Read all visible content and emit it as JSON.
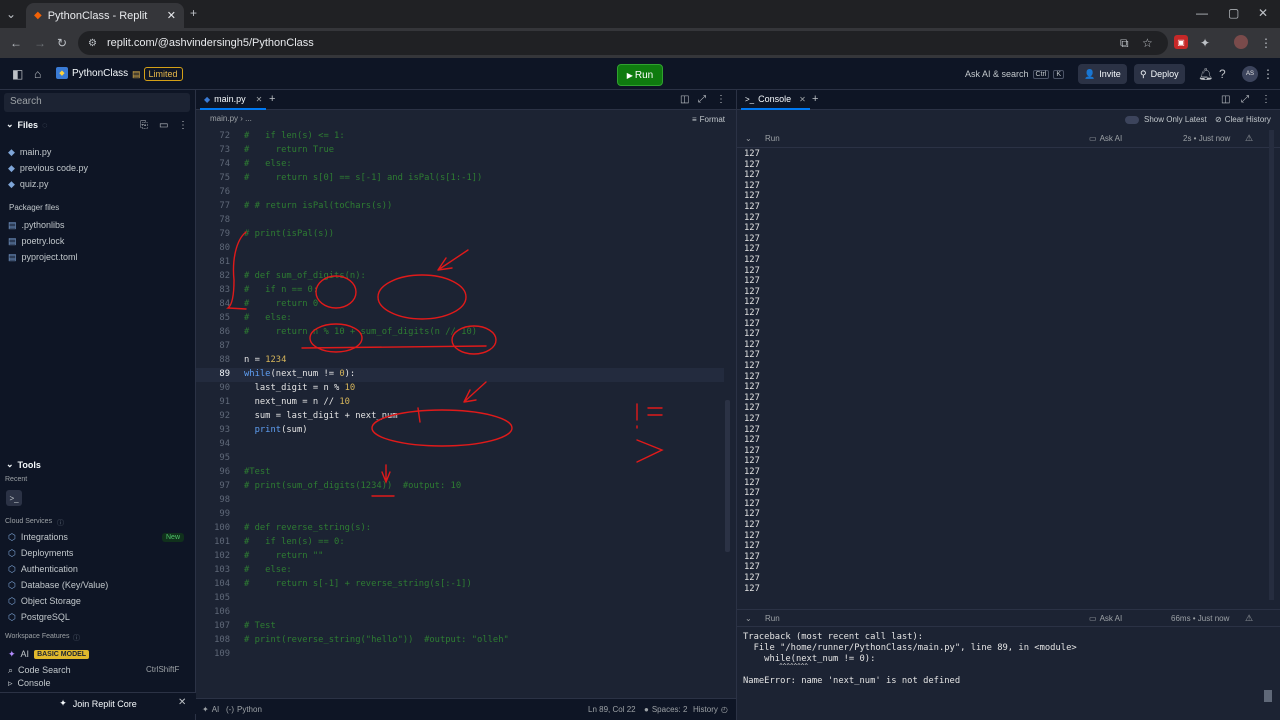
{
  "browser": {
    "tab_title": "PythonClass - Replit",
    "url": "replit.com/@ashvindersingh5/PythonClass"
  },
  "header": {
    "project_name": "PythonClass",
    "plan_badge": "Limited",
    "run_label": "Run",
    "search_label": "Ask AI & search",
    "shortcut_ctrl": "Ctrl",
    "shortcut_key": "K",
    "invite_label": "Invite",
    "deploy_label": "Deploy",
    "avatar_initials": "AS"
  },
  "sidebar": {
    "search_placeholder": "Search",
    "files_label": "Files",
    "files": [
      "main.py",
      "previous code.py",
      "quiz.py"
    ],
    "packager_label": "Packager files",
    "packager_files": [
      ".pythonlibs",
      "poetry.lock",
      "pyproject.toml"
    ],
    "tools_label": "Tools",
    "recent_label": "Recent",
    "cloud_label": "Cloud Services",
    "cloud_items": [
      "Integrations",
      "Deployments",
      "Authentication",
      "Database (Key/Value)",
      "Object Storage",
      "PostgreSQL"
    ],
    "new_badge": "New",
    "workspace_label": "Workspace Features",
    "ai_label": "AI",
    "ai_badge": "BASIC MODEL",
    "code_search_label": "Code Search",
    "code_search_shortcut": "CtrlShiftF",
    "console_item": "Console",
    "join_core": "Join Replit Core"
  },
  "editor": {
    "tab_label": "main.py",
    "crumb_file": "main.py",
    "crumb_more": "...",
    "format_label": "Format",
    "lines": [
      {
        "n": "72",
        "t": "#   if len(s) <= 1:",
        "c": "cm"
      },
      {
        "n": "73",
        "t": "#     return True",
        "c": "cm"
      },
      {
        "n": "74",
        "t": "#   else:",
        "c": "cm"
      },
      {
        "n": "75",
        "t": "#     return s[0] == s[-1] and isPal(s[1:-1])",
        "c": "cm"
      },
      {
        "n": "76",
        "t": "",
        "c": ""
      },
      {
        "n": "77",
        "t": "# # return isPal(toChars(s))",
        "c": "cm"
      },
      {
        "n": "78",
        "t": "",
        "c": ""
      },
      {
        "n": "79",
        "t": "# print(isPal(s))",
        "c": "cm"
      },
      {
        "n": "80",
        "t": "",
        "c": ""
      },
      {
        "n": "81",
        "t": "",
        "c": ""
      },
      {
        "n": "82",
        "t": "# def sum_of_digits(n):",
        "c": "cm"
      },
      {
        "n": "83",
        "t": "#   if n == 0:",
        "c": "cm"
      },
      {
        "n": "84",
        "t": "#     return 0",
        "c": "cm"
      },
      {
        "n": "85",
        "t": "#   else:",
        "c": "cm"
      },
      {
        "n": "86",
        "t": "#     return n % 10 + sum_of_digits(n // 10)",
        "c": "cm"
      },
      {
        "n": "87",
        "t": "",
        "c": ""
      },
      {
        "n": "88",
        "t": "n = 1234",
        "c": "code"
      },
      {
        "n": "89",
        "t": "while(next_num != 0):",
        "c": "code"
      },
      {
        "n": "90",
        "t": "  last_digit = n % 10",
        "c": "code"
      },
      {
        "n": "91",
        "t": "  next_num = n // 10",
        "c": "code"
      },
      {
        "n": "92",
        "t": "  sum = last_digit + next_num",
        "c": "code"
      },
      {
        "n": "93",
        "t": "  print(sum)",
        "c": "code"
      },
      {
        "n": "94",
        "t": "",
        "c": ""
      },
      {
        "n": "95",
        "t": "",
        "c": ""
      },
      {
        "n": "96",
        "t": "#Test",
        "c": "cm"
      },
      {
        "n": "97",
        "t": "# print(sum_of_digits(1234))  #output: 10",
        "c": "cm"
      },
      {
        "n": "98",
        "t": "",
        "c": ""
      },
      {
        "n": "99",
        "t": "",
        "c": ""
      },
      {
        "n": "100",
        "t": "# def reverse_string(s):",
        "c": "cm"
      },
      {
        "n": "101",
        "t": "#   if len(s) == 0:",
        "c": "cm"
      },
      {
        "n": "102",
        "t": "#     return \"\"",
        "c": "cm"
      },
      {
        "n": "103",
        "t": "#   else:",
        "c": "cm"
      },
      {
        "n": "104",
        "t": "#     return s[-1] + reverse_string(s[:-1])",
        "c": "cm"
      },
      {
        "n": "105",
        "t": "",
        "c": ""
      },
      {
        "n": "106",
        "t": "",
        "c": ""
      },
      {
        "n": "107",
        "t": "# Test",
        "c": "cm"
      },
      {
        "n": "108",
        "t": "# print(reverse_string(\"hello\"))  #output: \"olleh\"",
        "c": "cm"
      },
      {
        "n": "109",
        "t": "",
        "c": ""
      }
    ],
    "status_ai": "AI",
    "status_lang": "Python",
    "status_pos": "Ln 89, Col 22",
    "status_spaces": "Spaces: 2",
    "status_history": "History"
  },
  "console": {
    "tab_label": "Console",
    "show_only_latest": "Show Only Latest",
    "clear_history": "Clear History",
    "run1_label": "Run",
    "run1_ask": "Ask AI",
    "run1_time": "2s • Just now",
    "output_value": "127",
    "output_count": 42,
    "run2_label": "Run",
    "run2_ask": "Ask AI",
    "run2_time": "66ms • Just now",
    "traceback": [
      "Traceback (most recent call last):",
      "  File \"/home/runner/PythonClass/main.py\", line 89, in <module>",
      "    while(next_num != 0):",
      "          ^^^^^^^^",
      "NameError: name 'next_num' is not defined"
    ]
  },
  "colors": {
    "annotation_red": "#e01a1a",
    "run_green": "#0f7b0f",
    "comment_green": "#2e7d32",
    "keyword_blue": "#5f9ff3",
    "number_yellow": "#d6b55a"
  }
}
